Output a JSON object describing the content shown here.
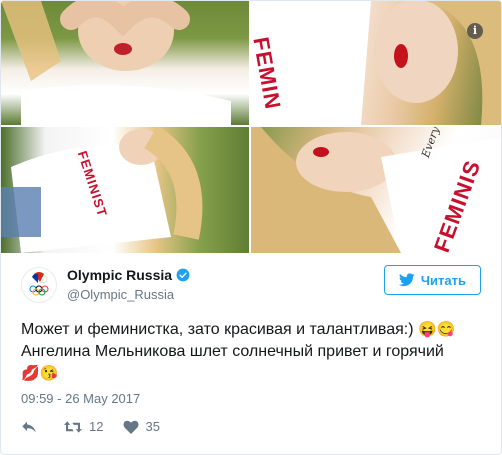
{
  "photos": [
    {
      "name": "photo-1"
    },
    {
      "name": "photo-2",
      "shirt_text": "FEMIN"
    },
    {
      "name": "photo-3",
      "shirt_text": "FEMINIST"
    },
    {
      "name": "photo-4",
      "shirt_text": "FEMINIS",
      "script_text": "Every day"
    }
  ],
  "info_icon": "i",
  "account": {
    "display_name": "Olympic Russia",
    "handle": "@Olympic_Russia",
    "avatar_icon": "olympic-russia-logo-icon",
    "verified_icon": "verified-badge-icon"
  },
  "follow_button": {
    "label": "Читать",
    "icon": "twitter-bird-icon"
  },
  "tweet": {
    "line1": "Может и феминистка, зато красивая и талантливая:)",
    "line1_emoji": "😝😋",
    "line2": "Ангелина Мельникова шлет солнечный привет и горячий",
    "line3_emoji": "💋😘"
  },
  "timestamp": "09:59 - 26 May 2017",
  "actions": {
    "reply_icon": "reply-icon",
    "retweet_icon": "retweet-icon",
    "retweet_count": "12",
    "like_icon": "heart-icon",
    "like_count": "35"
  },
  "colors": {
    "accent": "#1da1f2",
    "text": "#14171a",
    "muted": "#657786",
    "shirt_red": "#c8102e"
  }
}
